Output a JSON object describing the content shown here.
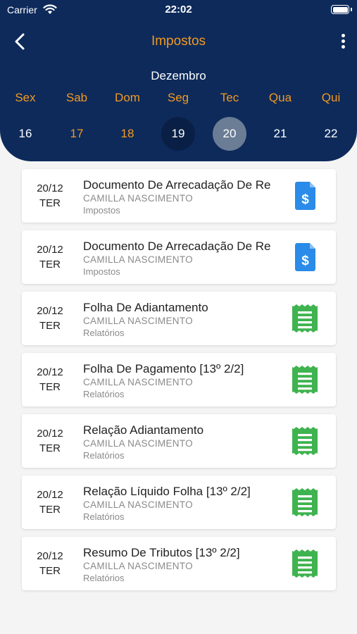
{
  "status_bar": {
    "carrier": "Carrier",
    "time": "22:02"
  },
  "header": {
    "title": "Impostos",
    "month": "Dezembro"
  },
  "days": [
    {
      "name": "Sex",
      "num": "16",
      "style": "white"
    },
    {
      "name": "Sab",
      "num": "17",
      "style": "orange"
    },
    {
      "name": "Dom",
      "num": "18",
      "style": "orange"
    },
    {
      "name": "Seg",
      "num": "19",
      "style": "today"
    },
    {
      "name": "Tec",
      "num": "20",
      "style": "selected"
    },
    {
      "name": "Qua",
      "num": "21",
      "style": "white"
    },
    {
      "name": "Qui",
      "num": "22",
      "style": "white"
    }
  ],
  "items": [
    {
      "date": "20/12",
      "weekday": "TER",
      "title": "Documento De Arrecadação De Re",
      "subtitle": "CAMILLA NASCIMENTO",
      "category": "Impostos",
      "icon": "invoice-icon"
    },
    {
      "date": "20/12",
      "weekday": "TER",
      "title": "Documento De Arrecadação De Re",
      "subtitle": "CAMILLA NASCIMENTO",
      "category": "Impostos",
      "icon": "invoice-icon"
    },
    {
      "date": "20/12",
      "weekday": "TER",
      "title": "Folha De Adiantamento",
      "subtitle": "CAMILLA NASCIMENTO",
      "category": "Relatórios",
      "icon": "receipt-icon"
    },
    {
      "date": "20/12",
      "weekday": "TER",
      "title": "Folha De Pagamento [13º 2/2]",
      "subtitle": "CAMILLA NASCIMENTO",
      "category": "Relatórios",
      "icon": "receipt-icon"
    },
    {
      "date": "20/12",
      "weekday": "TER",
      "title": "Relação Adiantamento",
      "subtitle": "CAMILLA NASCIMENTO",
      "category": "Relatórios",
      "icon": "receipt-icon"
    },
    {
      "date": "20/12",
      "weekday": "TER",
      "title": "Relação Líquido Folha [13º 2/2]",
      "subtitle": "CAMILLA NASCIMENTO",
      "category": "Relatórios",
      "icon": "receipt-icon"
    },
    {
      "date": "20/12",
      "weekday": "TER",
      "title": "Resumo De Tributos [13º 2/2]",
      "subtitle": "CAMILLA NASCIMENTO",
      "category": "Relatórios",
      "icon": "receipt-icon"
    }
  ],
  "colors": {
    "header_bg": "#0d2a5b",
    "accent": "#f39a1f",
    "invoice_icon": "#2a8be8",
    "receipt_icon": "#3fb34f"
  }
}
